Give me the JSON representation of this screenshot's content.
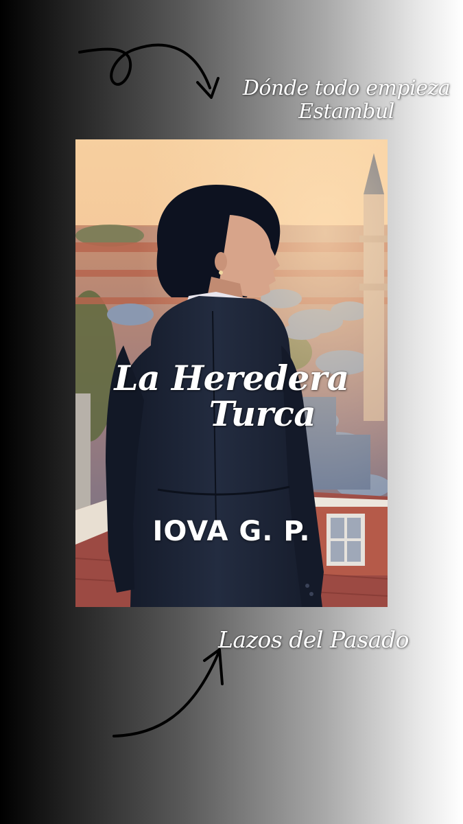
{
  "captions": {
    "top_line1": "Dónde todo empieza",
    "top_line2": "Estambul",
    "bottom": "Lazos del Pasado"
  },
  "cover": {
    "title_line1": "La Heredera",
    "title_line2": "Turca",
    "author": "IOVA G. P."
  },
  "colors": {
    "background_left": "#000000",
    "background_right": "#ffffff",
    "text": "#ffffff",
    "sky_top": "#f2c89a",
    "suit": "#1b2233",
    "domes": "#7f8ea6",
    "roofs": "#b86a52"
  },
  "icons": [
    "curved-arrow-top-icon",
    "curved-arrow-bottom-icon"
  ]
}
